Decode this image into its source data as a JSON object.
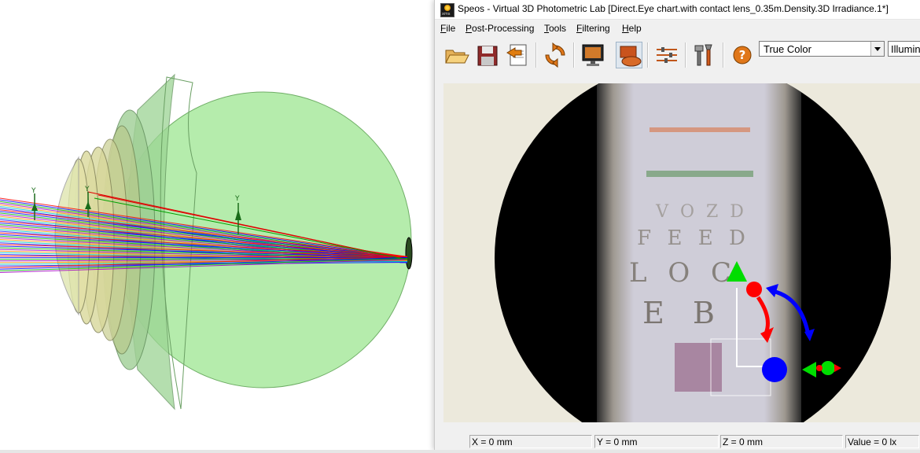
{
  "window": {
    "title": "Speos - Virtual 3D Photometric Lab [Direct.Eye chart.with contact lens_0.35m.Density.3D Irradiance.1*]"
  },
  "menu": {
    "items": [
      {
        "label": "File",
        "accel": "F",
        "rest": "ile"
      },
      {
        "label": "Post-Processing",
        "accel": "P",
        "rest": "ost-Processing"
      },
      {
        "label": "Tools",
        "accel": "T",
        "rest": "ools"
      },
      {
        "label": "Filtering",
        "accel": "F",
        "rest": "iltering"
      },
      {
        "label": "Help",
        "accel": "H",
        "rest": "elp"
      }
    ]
  },
  "toolbar": {
    "icons": [
      "open-folder-icon",
      "save-icon",
      "export-icon",
      "refresh-icon",
      "monitor-icon",
      "display-mode-icon",
      "sliders-icon",
      "tools-icon",
      "help-icon"
    ],
    "color_mode": {
      "value": "True Color"
    },
    "unit_mode": {
      "value": "Illuminance"
    }
  },
  "scene": {
    "axis_labels": [
      "Y",
      "Y",
      "Y"
    ],
    "ray_colors": [
      "#ff0000",
      "#0000ff",
      "#00b000",
      "#a000c0",
      "#ff8c00",
      "#00c8c8",
      "#2020ff"
    ],
    "eye_color": "#a8eaa0"
  },
  "viewer": {
    "chart_lines": [
      {
        "text": "",
        "color": "#d68a6a"
      },
      {
        "text": "",
        "color": "#6b9a6b"
      },
      {
        "text": "V O Z D",
        "color": "#9a9590"
      },
      {
        "text": "F E E D",
        "color": "#8c867f"
      },
      {
        "text": "L O C",
        "color": "#7a746c"
      },
      {
        "text": "E B",
        "color": "#6e6860"
      }
    ],
    "gizmo_colors": {
      "x": "#ff0000",
      "y": "#00dd00",
      "z": "#0000ff"
    }
  },
  "status": {
    "x": "X = 0 mm",
    "y": "Y = 0 mm",
    "z": "Z = 0 mm",
    "value": "Value = 0 lx"
  }
}
